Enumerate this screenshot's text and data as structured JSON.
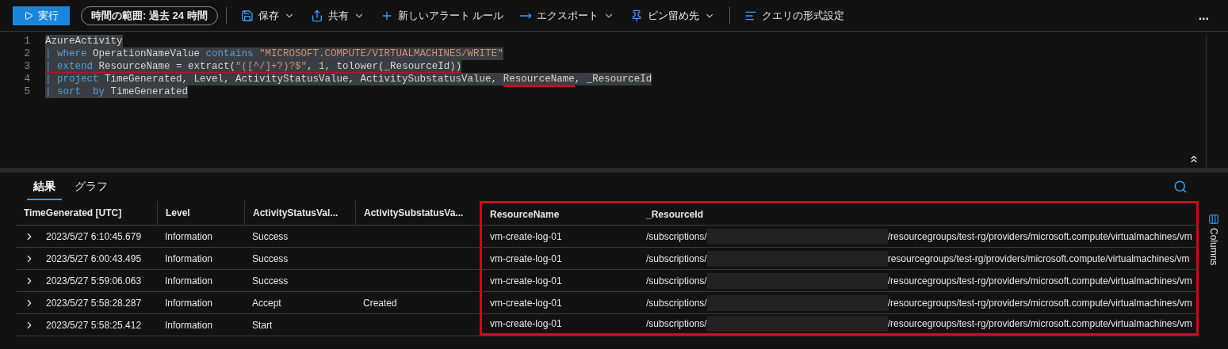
{
  "toolbar": {
    "run_button": "実行",
    "time_range": "時間の範囲: 過去 24 時間",
    "items": [
      {
        "kind": "save",
        "label": "保存",
        "dropdown": true
      },
      {
        "kind": "share",
        "label": "共有",
        "dropdown": true
      },
      {
        "kind": "alert",
        "label": "新しいアラート ルール",
        "dropdown": false
      },
      {
        "kind": "export",
        "label": "エクスポート",
        "dropdown": true
      },
      {
        "kind": "pin",
        "label": "ピン留め先",
        "dropdown": true
      },
      {
        "kind": "format",
        "label": "クエリの形式設定",
        "dropdown": false
      }
    ],
    "more": "..."
  },
  "editor": {
    "lines": [
      {
        "number": "1",
        "selected": true,
        "tokens": [
          {
            "kind": "plain",
            "text": "AzureActivity",
            "underlined": false
          }
        ]
      },
      {
        "number": "2",
        "selected": true,
        "tokens": [
          {
            "kind": "pipe",
            "text": "| ",
            "underlined": false
          },
          {
            "kind": "keyword",
            "text": "where",
            "underlined": false
          },
          {
            "kind": "plain",
            "text": " OperationNameValue ",
            "underlined": false
          },
          {
            "kind": "keyword",
            "text": "contains",
            "underlined": false
          },
          {
            "kind": "string",
            "text": " \"MICROSOFT.COMPUTE/VIRTUALMACHINES/WRITE\"",
            "underlined": false
          }
        ]
      },
      {
        "number": "3",
        "selected": true,
        "tokens": [
          {
            "kind": "pipe",
            "text": "| ",
            "underlined": true
          },
          {
            "kind": "keyword",
            "text": "extend",
            "underlined": true
          },
          {
            "kind": "plain",
            "text": " ResourceName = extract(",
            "underlined": true
          },
          {
            "kind": "string",
            "text": "\"([^/]+?)?$\"",
            "underlined": true
          },
          {
            "kind": "plain",
            "text": ", ",
            "underlined": true
          },
          {
            "kind": "number",
            "text": "1",
            "underlined": true
          },
          {
            "kind": "plain",
            "text": ", tolower(_ResourceId))",
            "underlined": true
          }
        ]
      },
      {
        "number": "4",
        "selected": true,
        "tokens": [
          {
            "kind": "pipe",
            "text": "| ",
            "underlined": false
          },
          {
            "kind": "keyword",
            "text": "project",
            "underlined": false
          },
          {
            "kind": "plain",
            "text": " TimeGenerated, Level, ActivityStatusValue, ActivitySubstatusValue, ",
            "underlined": false
          },
          {
            "kind": "plain",
            "text": "ResourceName",
            "underlined": true
          },
          {
            "kind": "plain",
            "text": ", _ResourceId",
            "underlined": false
          }
        ]
      },
      {
        "number": "5",
        "selected": true,
        "tokens": [
          {
            "kind": "pipe",
            "text": "| ",
            "underlined": false
          },
          {
            "kind": "keyword",
            "text": "sort",
            "underlined": false
          },
          {
            "kind": "keyword",
            "text": "  by",
            "underlined": false
          },
          {
            "kind": "plain",
            "text": " TimeGenerated",
            "underlined": false
          }
        ]
      }
    ]
  },
  "results": {
    "tabs": [
      {
        "label": "結果",
        "selected": true
      },
      {
        "label": "グラフ",
        "selected": false
      }
    ],
    "columns": [
      {
        "label": "TimeGenerated [UTC]",
        "highlighted": false
      },
      {
        "label": "Level",
        "highlighted": false
      },
      {
        "label": "ActivityStatusVal...",
        "highlighted": false
      },
      {
        "label": "ActivitySubstatusVa...",
        "highlighted": false
      },
      {
        "label": "ResourceName",
        "highlighted": true
      },
      {
        "label": "_ResourceId",
        "highlighted": true
      }
    ],
    "rows": [
      {
        "cells": [
          "2023/5/27 6:10:45.679",
          "Information",
          "Success",
          "",
          "vm-create-log-01"
        ],
        "resource_id": {
          "prefix": "/subscriptions/",
          "suffix": "/resourcegroups/test-rg/providers/microsoft.compute/virtualmachines/vm"
        }
      },
      {
        "cells": [
          "2023/5/27 6:00:43.495",
          "Information",
          "Success",
          "",
          "vm-create-log-01"
        ],
        "resource_id": {
          "prefix": "/subscriptions/",
          "suffix": "resourcegroups/test-rg/providers/microsoft.compute/virtualmachines/vm"
        }
      },
      {
        "cells": [
          "2023/5/27 5:59:06.063",
          "Information",
          "Success",
          "",
          "vm-create-log-01"
        ],
        "resource_id": {
          "prefix": "/subscriptions/",
          "suffix": "/resourcegroups/test-rg/providers/microsoft.compute/virtualmachines/vm"
        }
      },
      {
        "cells": [
          "2023/5/27 5:58:28.287",
          "Information",
          "Accept",
          "Created",
          "vm-create-log-01"
        ],
        "resource_id": {
          "prefix": "/subscriptions/",
          "suffix": "/resourcegroups/test-rg/providers/microsoft.compute/virtualmachines/vm"
        }
      },
      {
        "cells": [
          "2023/5/27 5:58:25.412",
          "Information",
          "Start",
          "",
          "vm-create-log-01"
        ],
        "resource_id": {
          "prefix": "/subscriptions/",
          "suffix": "/resourcegroups/test-rg/providers/microsoft.compute/virtualmachines/vm"
        }
      }
    ],
    "columns_panel": "Columns"
  }
}
